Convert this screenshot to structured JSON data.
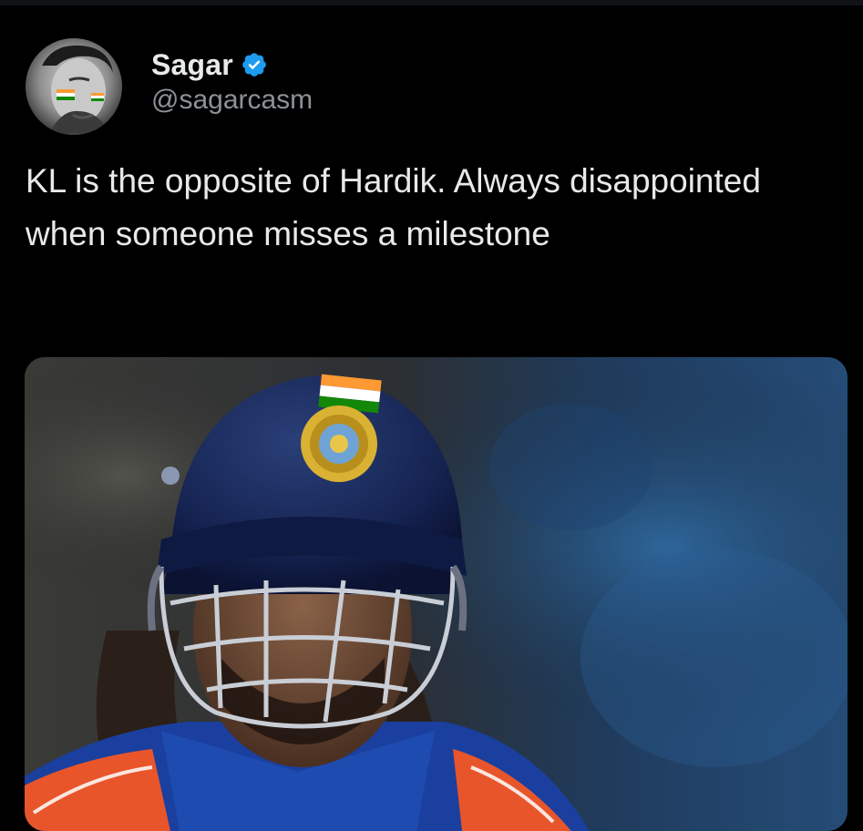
{
  "tweet": {
    "author": {
      "display_name": "Sagar",
      "handle": "@sagarcasm",
      "verified": true,
      "verified_color": "#1d9bf0",
      "avatar_icon": "profile-photo"
    },
    "text": "KL is the opposite of Hardik. Always disappointed when someone misses a milestone",
    "media": {
      "kind": "photo",
      "subject_icon": "cricketer-helmet-photo"
    }
  },
  "colors": {
    "background": "#000000",
    "text_primary": "#e7e9ea",
    "text_secondary": "#8b9298",
    "accent": "#1d9bf0"
  }
}
